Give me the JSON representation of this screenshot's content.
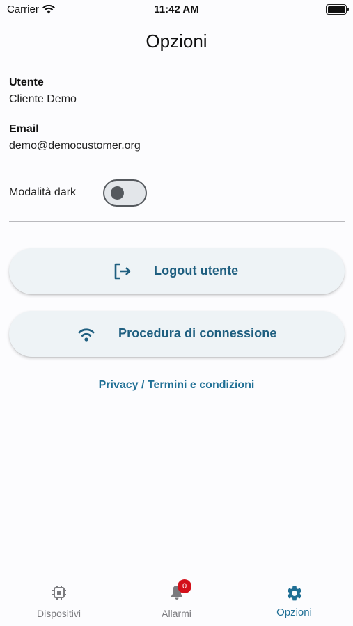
{
  "status_bar": {
    "carrier": "Carrier",
    "time": "11:42 AM"
  },
  "header": {
    "title": "Opzioni"
  },
  "user": {
    "label": "Utente",
    "value": "Cliente Demo"
  },
  "email": {
    "label": "Email",
    "value": "demo@democustomer.org"
  },
  "dark_mode": {
    "label": "Modalità dark",
    "enabled": false
  },
  "buttons": {
    "logout_label": "Logout utente",
    "connection_label": "Procedura di connessione"
  },
  "links": {
    "privacy_label": "Privacy / Termini e condizioni"
  },
  "tab_bar": {
    "tabs": [
      {
        "label": "Dispositivi",
        "icon": "chip-icon",
        "active": false
      },
      {
        "label": "Allarmi",
        "icon": "bell-icon",
        "active": false,
        "badge": "0"
      },
      {
        "label": "Opzioni",
        "icon": "gear-icon",
        "active": true
      }
    ]
  },
  "colors": {
    "accent": "#1f6f95",
    "button_text": "#1f5f80",
    "button_bg": "#eef3f6",
    "badge": "#d3101a",
    "inactive": "#7a7a7e"
  }
}
